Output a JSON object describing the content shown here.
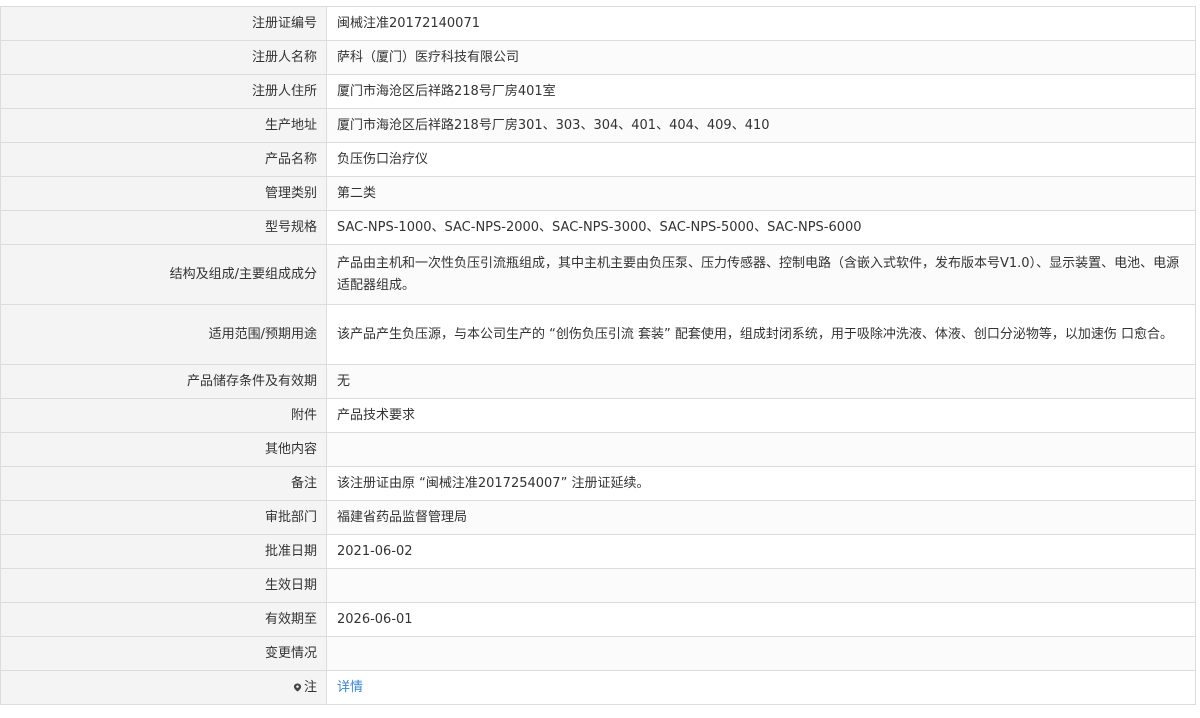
{
  "rows": [
    {
      "label": "注册证编号",
      "value": "闽械注准20172140071"
    },
    {
      "label": "注册人名称",
      "value": "萨科（厦门）医疗科技有限公司"
    },
    {
      "label": "注册人住所",
      "value": "厦门市海沧区后祥路218号厂房401室"
    },
    {
      "label": "生产地址",
      "value": "厦门市海沧区后祥路218号厂房301、303、304、401、404、409、410"
    },
    {
      "label": "产品名称",
      "value": "负压伤口治疗仪"
    },
    {
      "label": "管理类别",
      "value": "第二类"
    },
    {
      "label": "型号规格",
      "value": "SAC-NPS-1000、SAC-NPS-2000、SAC-NPS-3000、SAC-NPS-5000、SAC-NPS-6000"
    },
    {
      "label": "结构及组成/主要组成成分",
      "value": "产品由主机和一次性负压引流瓶组成，其中主机主要由负压泵、压力传感器、控制电路（含嵌入式软件，发布版本号V1.0）、显示装置、电池、电源适配器组成。"
    },
    {
      "label": "适用范围/预期用途",
      "value": "该产品产生负压源，与本公司生产的 “创伤负压引流 套装” 配套使用，组成封闭系统，用于吸除冲洗液、体液、创口分泌物等，以加速伤 口愈合。"
    },
    {
      "label": "产品储存条件及有效期",
      "value": "无"
    },
    {
      "label": "附件",
      "value": "产品技术要求"
    },
    {
      "label": "其他内容",
      "value": ""
    },
    {
      "label": "备注",
      "value": "该注册证由原 “闽械注准2017254007” 注册证延续。"
    },
    {
      "label": "审批部门",
      "value": "福建省药品监督管理局"
    },
    {
      "label": "批准日期",
      "value": "2021-06-02"
    },
    {
      "label": "生效日期",
      "value": ""
    },
    {
      "label": "有效期至",
      "value": "2026-06-01"
    },
    {
      "label": "变更情况",
      "value": ""
    }
  ],
  "note": {
    "label": "注",
    "icon": "map-pin-icon",
    "link_text": "详情",
    "link_color": "#3a86d9"
  }
}
